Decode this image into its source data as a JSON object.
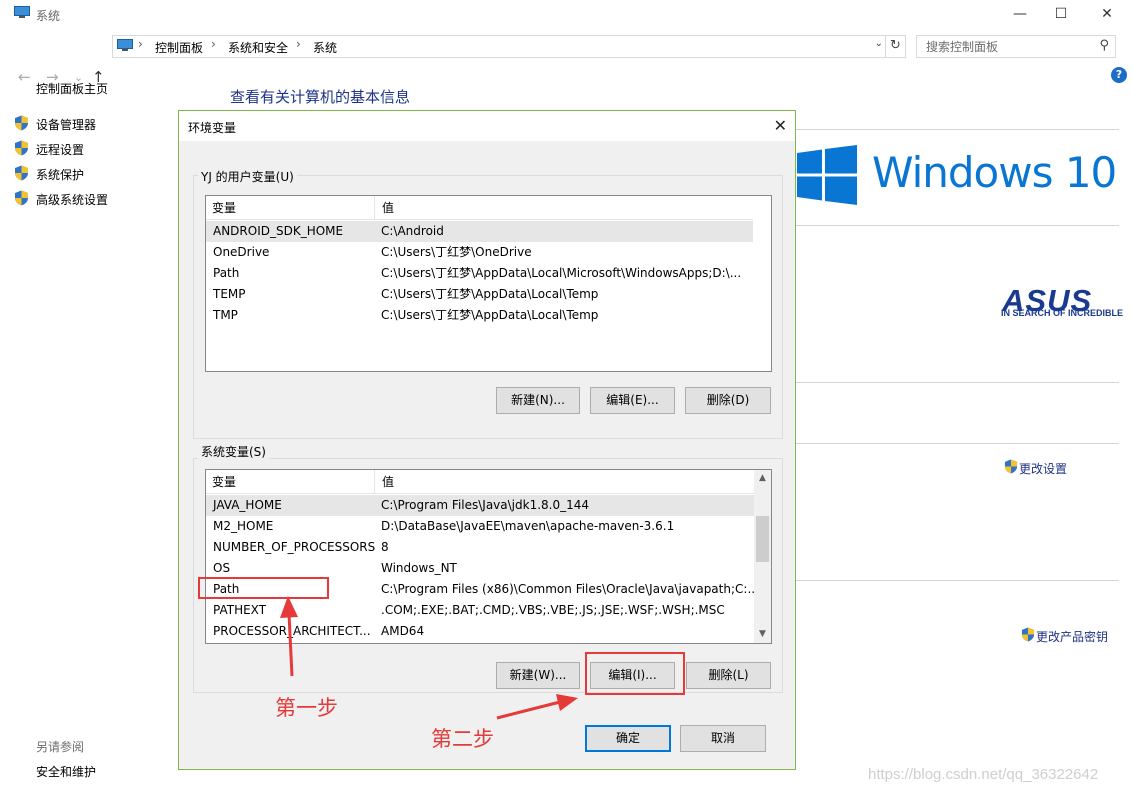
{
  "window": {
    "title": "系统",
    "buttons": {
      "minimize": "—",
      "maximize": "☐",
      "close": "✕"
    }
  },
  "nav": {
    "back": "←",
    "forward": "→",
    "dropdown": "⌄",
    "up": "↑",
    "breadcrumb": [
      "控制面板",
      "系统和安全",
      "系统"
    ],
    "separator": "›",
    "address_dropdown": "⌄",
    "refresh": "↻",
    "search_placeholder": "搜索控制面板",
    "search_icon": "⚲"
  },
  "help_icon": "?",
  "sidebar": {
    "home": "控制面板主页",
    "items": [
      "设备管理器",
      "远程设置",
      "系统保护",
      "高级系统设置"
    ],
    "see_also_title": "另请参阅",
    "see_also": [
      "安全和维护"
    ]
  },
  "main": {
    "heading": "查看有关计算机的基本信息",
    "windows_brand": "Windows 10",
    "oem_brand": "ASUS",
    "oem_tagline": "IN SEARCH OF INCREDIBLE",
    "change_settings": "更改设置",
    "change_product_key": "更改产品密钥"
  },
  "dialog": {
    "title": "环境变量",
    "close": "✕",
    "user_group_label": "YJ 的用户变量(U)",
    "system_group_label": "系统变量(S)",
    "col_var": "变量",
    "col_val": "值",
    "user_vars": [
      {
        "name": "ANDROID_SDK_HOME",
        "value": "C:\\Android"
      },
      {
        "name": "OneDrive",
        "value": "C:\\Users\\丁红梦\\OneDrive"
      },
      {
        "name": "Path",
        "value": "C:\\Users\\丁红梦\\AppData\\Local\\Microsoft\\WindowsApps;D:\\..."
      },
      {
        "name": "TEMP",
        "value": "C:\\Users\\丁红梦\\AppData\\Local\\Temp"
      },
      {
        "name": "TMP",
        "value": "C:\\Users\\丁红梦\\AppData\\Local\\Temp"
      }
    ],
    "system_vars": [
      {
        "name": "JAVA_HOME",
        "value": "C:\\Program Files\\Java\\jdk1.8.0_144"
      },
      {
        "name": "M2_HOME",
        "value": "D:\\DataBase\\JavaEE\\maven\\apache-maven-3.6.1"
      },
      {
        "name": "NUMBER_OF_PROCESSORS",
        "value": "8"
      },
      {
        "name": "OS",
        "value": "Windows_NT"
      },
      {
        "name": "Path",
        "value": "C:\\Program Files (x86)\\Common Files\\Oracle\\Java\\javapath;C:..."
      },
      {
        "name": "PATHEXT",
        "value": ".COM;.EXE;.BAT;.CMD;.VBS;.VBE;.JS;.JSE;.WSF;.WSH;.MSC"
      },
      {
        "name": "PROCESSOR_ARCHITECT...",
        "value": "AMD64"
      }
    ],
    "user_buttons": {
      "new": "新建(N)...",
      "edit": "编辑(E)...",
      "delete": "删除(D)"
    },
    "system_buttons": {
      "new": "新建(W)...",
      "edit": "编辑(I)...",
      "delete": "删除(L)"
    },
    "ok": "确定",
    "cancel": "取消",
    "scroll_up": "▲",
    "scroll_down": "▼"
  },
  "annotations": {
    "step1": "第一步",
    "step2": "第二步",
    "color": "#e53a3a"
  },
  "watermark": "https://blog.csdn.net/qq_36322642"
}
